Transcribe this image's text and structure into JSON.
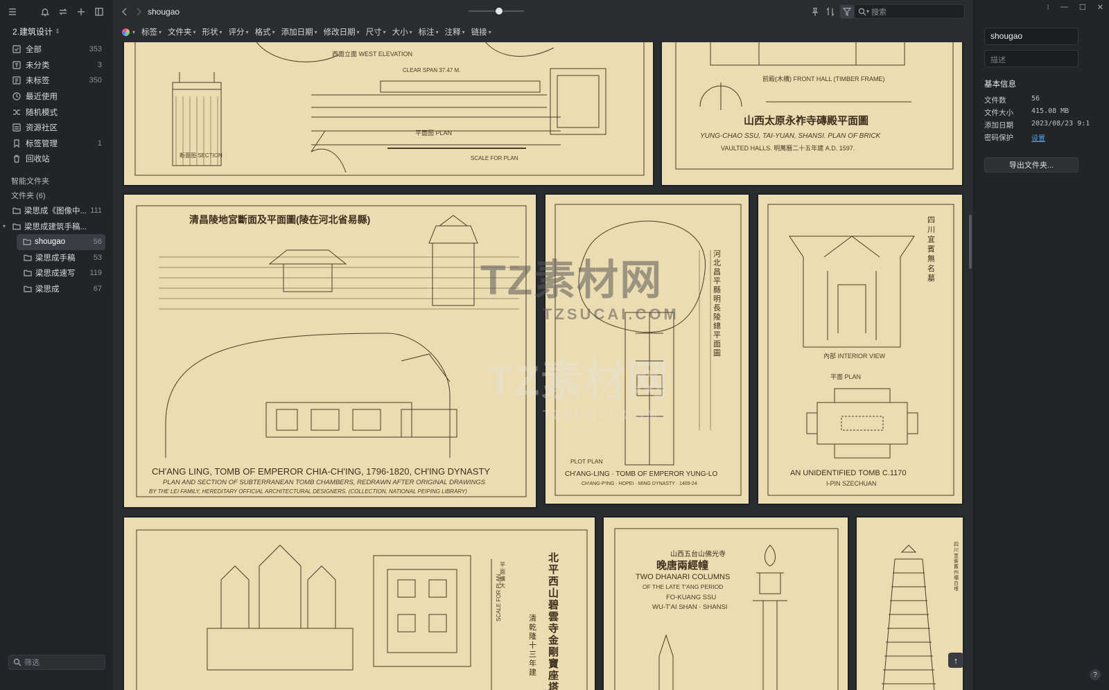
{
  "library": {
    "name": "2.建筑设计"
  },
  "nav": [
    {
      "label": "全部",
      "count": "353",
      "icon": "all-icon"
    },
    {
      "label": "未分类",
      "count": "3",
      "icon": "uncategorized-icon"
    },
    {
      "label": "未标签",
      "count": "350",
      "icon": "untagged-icon"
    },
    {
      "label": "最近使用",
      "count": "",
      "icon": "recent-icon"
    },
    {
      "label": "随机模式",
      "count": "",
      "icon": "shuffle-icon"
    },
    {
      "label": "资源社区",
      "count": "",
      "icon": "community-icon"
    },
    {
      "label": "标签管理",
      "count": "1",
      "icon": "tag-icon"
    },
    {
      "label": "回收站",
      "count": "",
      "icon": "trash-icon"
    }
  ],
  "sections": {
    "smart": "智能文件夹",
    "folders": "文件夹 (6)"
  },
  "folders": [
    {
      "label": "梁思成《图像中...",
      "count": "111"
    },
    {
      "label": "梁思成建筑手稿...",
      "count": ""
    },
    {
      "label": "shougao",
      "count": "56"
    },
    {
      "label": "梁思成手稿",
      "count": "53"
    },
    {
      "label": "梁思成速写",
      "count": "119"
    },
    {
      "label": "梁思成",
      "count": "67"
    }
  ],
  "sidebar_filter": {
    "placeholder": "筛选"
  },
  "topbar": {
    "crumb": "shougao",
    "search_placeholder": "搜索",
    "zoom_level": 0.55
  },
  "filters": [
    "标签",
    "文件夹",
    "形状",
    "评分",
    "格式",
    "添加日期",
    "修改日期",
    "尺寸",
    "大小",
    "标注",
    "注释",
    "链接"
  ],
  "cards": [
    {
      "t1": "西面立面  WEST ELEVATION",
      "t2": "CLEAR SPAN 37.47 M.",
      "t3": "断面图  SECTION",
      "t4": "平面图   PLAN",
      "t5": "SCALE FOR PLAN"
    },
    {
      "t1": "前殿(木構)  FRONT HALL (TIMBER FRAME)",
      "t2": "山西太原永祚寺磚殿平面圖",
      "t3": "YUNG-CHAO SSU, TAI-YUAN, SHANSI.  PLAN OF BRICK",
      "t4": "VAULTED HALLS.   明萬曆二十五年建   A.D. 1597."
    },
    {
      "t1": "清昌陵地宮斷面及平面圖(陵在河北省易縣)",
      "t2": "CH'ANG LING, TOMB OF EMPEROR CHIA-CH'ING, 1796-1820, CH'ING DYNASTY",
      "t3": "PLAN AND SECTION OF SUBTERRANEAN TOMB CHAMBERS, REDRAWN AFTER ORIGINAL DRAWINGS",
      "t4": "BY THE LEI FAMILY, HEREDITARY OFFICIAL ARCHITECTURAL DESIGNERS. (COLLECTION, NATIONAL PEIPING LIBRARY)"
    },
    {
      "t1": "河北昌平縣明長陵總平面圖",
      "t2": "PLOT PLAN",
      "t3": "CH'ANG-LING · TOMB OF EMPEROR YUNG-LO",
      "t4": "CH'ANG-P'ING · HOPEI · MING DYNASTY · 1409-24"
    },
    {
      "t1": "四川宜賓無名墓",
      "t2": "內部   INTERIOR VIEW",
      "t3": "平面   PLAN",
      "t4": "AN UNIDENTIFIED TOMB  C.1170",
      "t5": "I-PIN   SZECHUAN"
    },
    {
      "t1": "北平西山碧雲寺金剛寶座塔",
      "t2": "清乾隆十三年建",
      "t3": "SCALE FOR PLAN",
      "t4": "平面擴大"
    },
    {
      "t1": "山西五台山佛光寺",
      "t2": "晚唐兩經幢",
      "t3": "TWO DHANARI COLUMNS",
      "t4": "OF THE LATE T'ANG PERIOD",
      "t5": "FO-KUANG SSU",
      "t6": "WU-T'AI SHAN · SHANSI"
    },
    {
      "t1": "四川宜賓舊州壩白塔"
    }
  ],
  "watermark": {
    "main": "TZ素材网",
    "sub": "TZSUCAI.COM"
  },
  "panel": {
    "name": "shougao",
    "desc_placeholder": "描述",
    "section": "基本信息",
    "rows": [
      {
        "k": "文件数",
        "v": "56"
      },
      {
        "k": "文件大小",
        "v": "415.08 MB"
      },
      {
        "k": "添加日期",
        "v": "2023/08/23 9:1"
      },
      {
        "k": "密码保护",
        "v": "设置"
      }
    ],
    "export": "导出文件夹..."
  },
  "colors": {
    "paper": "#ecdcb1",
    "ink": "#4a3a26",
    "accent": "#5b9ee8"
  }
}
